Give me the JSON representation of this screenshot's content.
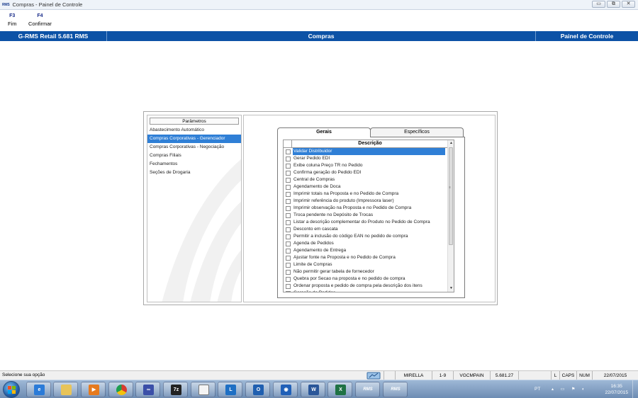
{
  "window": {
    "logo_text": "RMS",
    "title": "Compras - Painel de Controle",
    "controls": [
      "▭",
      "⧉",
      "✕"
    ]
  },
  "fkeys": [
    {
      "key": "F3",
      "label": "Fim"
    },
    {
      "key": "F4",
      "label": "Confirmar"
    }
  ],
  "header": {
    "product": "G-RMS Retail 5.681 RMS",
    "module": "Compras",
    "screen": "Painel de Controle"
  },
  "left_panel": {
    "header": "Parâmetros",
    "items": [
      "Abastecimento Automático",
      "Compras Corporativas - Gerenciador",
      "Compras Corporativas - Negociação",
      "Compras Filiais",
      "Fechamentos",
      "Seções de Drogaria"
    ],
    "selected_index": 1
  },
  "tabs": [
    {
      "label": "Gerais",
      "active": true
    },
    {
      "label": "Específicos",
      "active": false
    }
  ],
  "list": {
    "column_header": "Descrição",
    "selected_index": 0,
    "rows": [
      "Validar Distribuidor",
      "Gerar Pedido EDI",
      "Exibe coluna Preço TR no Pedido",
      "Confirma geração do Pedido EDI",
      "Central de Compras",
      "Agendamento de Doca",
      "Imprimir totais na Proposta e no Pedido de Compra",
      "Imprimir referência do produto (Impressora laser)",
      "Imprimir observação na Proposta e no Pedido de Compra",
      "Troca pendente no Depósito de Trocas",
      "Listar a descrição complementar do Produto no Pedido de Compra",
      "Desconto em cascata",
      "Permitir a inclusão do código EAN no pedido de compra",
      "Agenda de Pedidos",
      "Agendamento de Entrega",
      "Ajustar fonte na Proposta e no Pedido de Compra",
      "Limite de Compras",
      "Não permitir gerar tabela de fornecedor",
      "Quebra por Secao na proposta e no pedido de compra",
      "Ordenar proposta e pedido de compra pela descrição dos itens",
      "Geração de Pedidos"
    ]
  },
  "statusbar": {
    "message": "Selecione sua opção",
    "user": "MIRELLA",
    "range": "1-9",
    "program": "VGCMPAIN",
    "version": "5.681.27",
    "l": "L",
    "caps": "CAPS",
    "num": "NUM",
    "date": "22/07/2015"
  },
  "taskbar": {
    "apps": [
      {
        "name": "internet-explorer-icon",
        "text": "e",
        "color": "#2b7bd8"
      },
      {
        "name": "file-explorer-icon",
        "text": "",
        "color": "#e8c45a"
      },
      {
        "name": "media-player-icon",
        "text": "▶",
        "color": "#e67a1e"
      },
      {
        "name": "chrome-icon",
        "text": "",
        "color": "#d93b2f"
      },
      {
        "name": "infinity-app-icon",
        "text": "∞",
        "color": "#3b4fa8"
      },
      {
        "name": "7zip-icon",
        "text": "7z",
        "color": "#222222"
      },
      {
        "name": "document-icon",
        "text": "",
        "color": "#f4f4f4"
      },
      {
        "name": "lync-icon",
        "text": "L",
        "color": "#1e6fc4"
      },
      {
        "name": "outlook-icon",
        "text": "O",
        "color": "#1f5fb0"
      },
      {
        "name": "remote-desktop-icon",
        "text": "◉",
        "color": "#2060b8"
      },
      {
        "name": "word-icon",
        "text": "W",
        "color": "#2a5699"
      },
      {
        "name": "excel-icon",
        "text": "X",
        "color": "#1f7244"
      },
      {
        "name": "rms-app-icon-1",
        "text": "RMS",
        "color": "#1d3f8f"
      },
      {
        "name": "rms-app-icon-2",
        "text": "RMS",
        "color": "#1d3f8f"
      }
    ],
    "lang": "PT",
    "time": "16:35",
    "date": "22/07/2015"
  }
}
